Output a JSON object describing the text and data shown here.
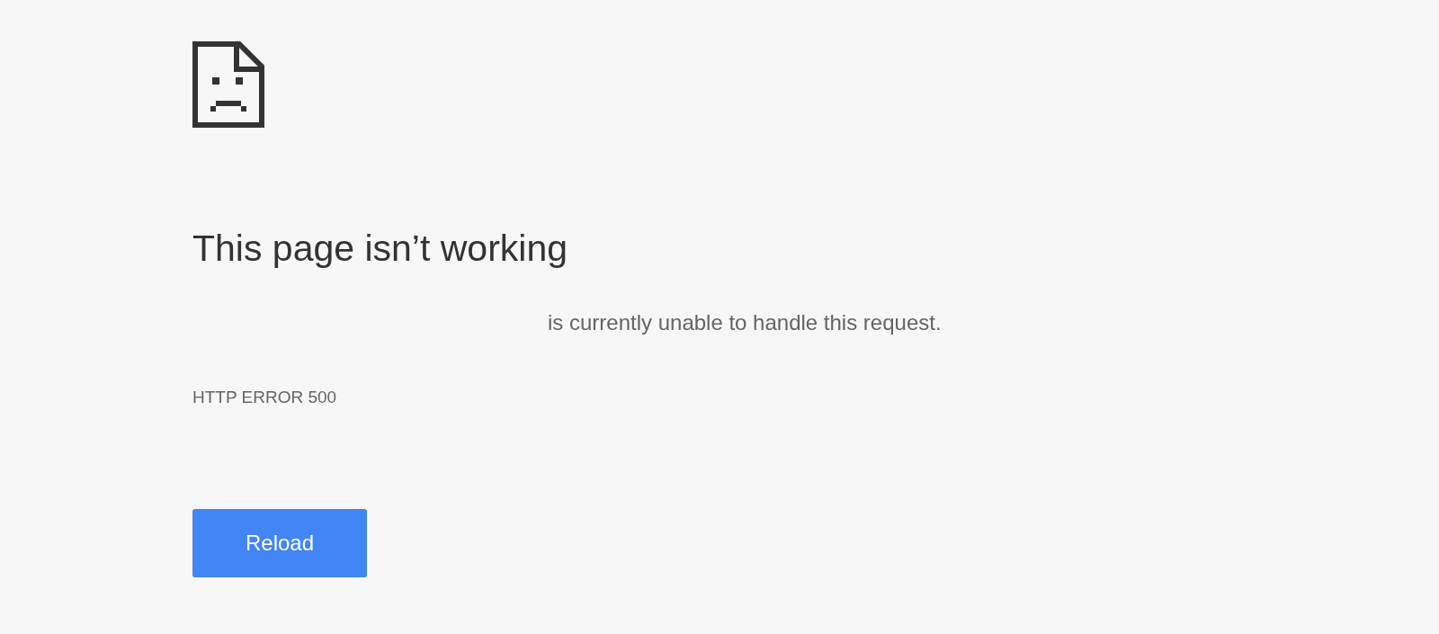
{
  "heading": "This page isn’t working",
  "message": "is currently unable to handle this request.",
  "error_code": "HTTP ERROR 500",
  "buttons": [
    {
      "label": "Reload"
    }
  ]
}
